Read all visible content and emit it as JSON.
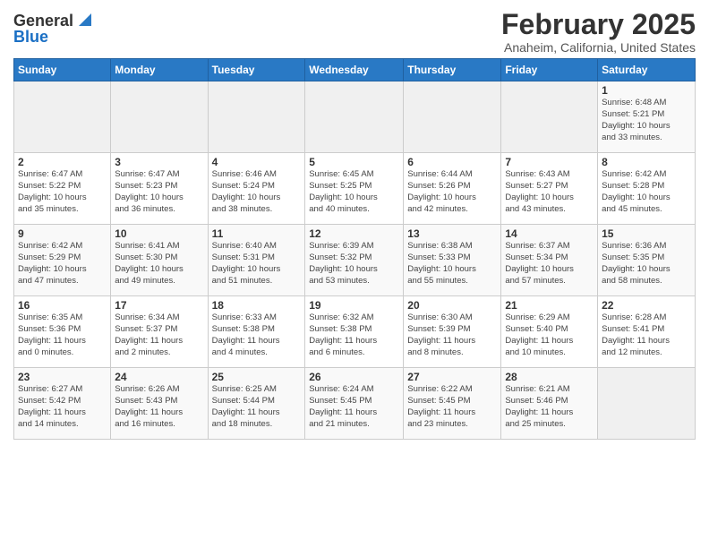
{
  "header": {
    "logo_general": "General",
    "logo_blue": "Blue",
    "month": "February 2025",
    "location": "Anaheim, California, United States"
  },
  "weekdays": [
    "Sunday",
    "Monday",
    "Tuesday",
    "Wednesday",
    "Thursday",
    "Friday",
    "Saturday"
  ],
  "weeks": [
    [
      {
        "day": "",
        "info": ""
      },
      {
        "day": "",
        "info": ""
      },
      {
        "day": "",
        "info": ""
      },
      {
        "day": "",
        "info": ""
      },
      {
        "day": "",
        "info": ""
      },
      {
        "day": "",
        "info": ""
      },
      {
        "day": "1",
        "info": "Sunrise: 6:48 AM\nSunset: 5:21 PM\nDaylight: 10 hours\nand 33 minutes."
      }
    ],
    [
      {
        "day": "2",
        "info": "Sunrise: 6:47 AM\nSunset: 5:22 PM\nDaylight: 10 hours\nand 35 minutes."
      },
      {
        "day": "3",
        "info": "Sunrise: 6:47 AM\nSunset: 5:23 PM\nDaylight: 10 hours\nand 36 minutes."
      },
      {
        "day": "4",
        "info": "Sunrise: 6:46 AM\nSunset: 5:24 PM\nDaylight: 10 hours\nand 38 minutes."
      },
      {
        "day": "5",
        "info": "Sunrise: 6:45 AM\nSunset: 5:25 PM\nDaylight: 10 hours\nand 40 minutes."
      },
      {
        "day": "6",
        "info": "Sunrise: 6:44 AM\nSunset: 5:26 PM\nDaylight: 10 hours\nand 42 minutes."
      },
      {
        "day": "7",
        "info": "Sunrise: 6:43 AM\nSunset: 5:27 PM\nDaylight: 10 hours\nand 43 minutes."
      },
      {
        "day": "8",
        "info": "Sunrise: 6:42 AM\nSunset: 5:28 PM\nDaylight: 10 hours\nand 45 minutes."
      }
    ],
    [
      {
        "day": "9",
        "info": "Sunrise: 6:42 AM\nSunset: 5:29 PM\nDaylight: 10 hours\nand 47 minutes."
      },
      {
        "day": "10",
        "info": "Sunrise: 6:41 AM\nSunset: 5:30 PM\nDaylight: 10 hours\nand 49 minutes."
      },
      {
        "day": "11",
        "info": "Sunrise: 6:40 AM\nSunset: 5:31 PM\nDaylight: 10 hours\nand 51 minutes."
      },
      {
        "day": "12",
        "info": "Sunrise: 6:39 AM\nSunset: 5:32 PM\nDaylight: 10 hours\nand 53 minutes."
      },
      {
        "day": "13",
        "info": "Sunrise: 6:38 AM\nSunset: 5:33 PM\nDaylight: 10 hours\nand 55 minutes."
      },
      {
        "day": "14",
        "info": "Sunrise: 6:37 AM\nSunset: 5:34 PM\nDaylight: 10 hours\nand 57 minutes."
      },
      {
        "day": "15",
        "info": "Sunrise: 6:36 AM\nSunset: 5:35 PM\nDaylight: 10 hours\nand 58 minutes."
      }
    ],
    [
      {
        "day": "16",
        "info": "Sunrise: 6:35 AM\nSunset: 5:36 PM\nDaylight: 11 hours\nand 0 minutes."
      },
      {
        "day": "17",
        "info": "Sunrise: 6:34 AM\nSunset: 5:37 PM\nDaylight: 11 hours\nand 2 minutes."
      },
      {
        "day": "18",
        "info": "Sunrise: 6:33 AM\nSunset: 5:38 PM\nDaylight: 11 hours\nand 4 minutes."
      },
      {
        "day": "19",
        "info": "Sunrise: 6:32 AM\nSunset: 5:38 PM\nDaylight: 11 hours\nand 6 minutes."
      },
      {
        "day": "20",
        "info": "Sunrise: 6:30 AM\nSunset: 5:39 PM\nDaylight: 11 hours\nand 8 minutes."
      },
      {
        "day": "21",
        "info": "Sunrise: 6:29 AM\nSunset: 5:40 PM\nDaylight: 11 hours\nand 10 minutes."
      },
      {
        "day": "22",
        "info": "Sunrise: 6:28 AM\nSunset: 5:41 PM\nDaylight: 11 hours\nand 12 minutes."
      }
    ],
    [
      {
        "day": "23",
        "info": "Sunrise: 6:27 AM\nSunset: 5:42 PM\nDaylight: 11 hours\nand 14 minutes."
      },
      {
        "day": "24",
        "info": "Sunrise: 6:26 AM\nSunset: 5:43 PM\nDaylight: 11 hours\nand 16 minutes."
      },
      {
        "day": "25",
        "info": "Sunrise: 6:25 AM\nSunset: 5:44 PM\nDaylight: 11 hours\nand 18 minutes."
      },
      {
        "day": "26",
        "info": "Sunrise: 6:24 AM\nSunset: 5:45 PM\nDaylight: 11 hours\nand 21 minutes."
      },
      {
        "day": "27",
        "info": "Sunrise: 6:22 AM\nSunset: 5:45 PM\nDaylight: 11 hours\nand 23 minutes."
      },
      {
        "day": "28",
        "info": "Sunrise: 6:21 AM\nSunset: 5:46 PM\nDaylight: 11 hours\nand 25 minutes."
      },
      {
        "day": "",
        "info": ""
      }
    ]
  ]
}
